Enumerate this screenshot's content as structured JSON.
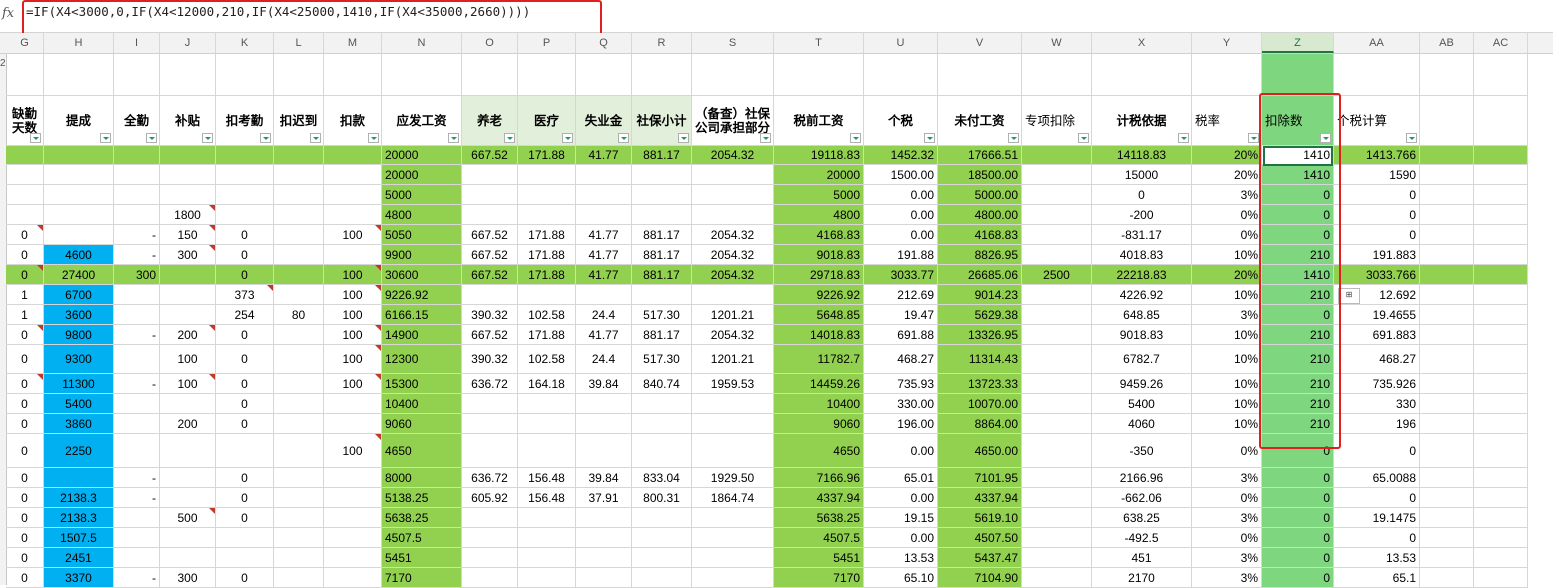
{
  "formula_bar": {
    "fx_label": "fx",
    "formula": "=IF(X4<3000,0,IF(X4<12000,210,IF(X4<25000,1410,IF(X4<35000,2660))))"
  },
  "columns": [
    {
      "key": "G",
      "w": 38
    },
    {
      "key": "H",
      "w": 70
    },
    {
      "key": "I",
      "w": 46
    },
    {
      "key": "J",
      "w": 56
    },
    {
      "key": "K",
      "w": 58
    },
    {
      "key": "L",
      "w": 50
    },
    {
      "key": "M",
      "w": 58
    },
    {
      "key": "N",
      "w": 80
    },
    {
      "key": "O",
      "w": 56
    },
    {
      "key": "P",
      "w": 58
    },
    {
      "key": "Q",
      "w": 56
    },
    {
      "key": "R",
      "w": 60
    },
    {
      "key": "S",
      "w": 82
    },
    {
      "key": "T",
      "w": 90
    },
    {
      "key": "U",
      "w": 74
    },
    {
      "key": "V",
      "w": 84
    },
    {
      "key": "W",
      "w": 70
    },
    {
      "key": "X",
      "w": 100
    },
    {
      "key": "Y",
      "w": 70
    },
    {
      "key": "Z",
      "w": 72
    },
    {
      "key": "AA",
      "w": 86
    },
    {
      "key": "AB",
      "w": 54
    },
    {
      "key": "AC",
      "w": 54
    }
  ],
  "row2_label": "2",
  "headers": [
    "缺勤天数",
    "提成",
    "全勤",
    "补贴",
    "扣考勤",
    "扣迟到",
    "扣款",
    "应发工资",
    "养老",
    "医疗",
    "失业金",
    "社保小计",
    "（备查）社保公司承担部分",
    "税前工资",
    "个税",
    "未付工资",
    "专项扣除",
    "计税依据",
    "税率",
    "扣除数",
    "个税计算",
    "",
    ""
  ],
  "rows": [
    [
      "",
      "",
      "",
      "",
      "",
      "",
      "",
      "20000",
      "667.52",
      "171.88",
      "41.77",
      "881.17",
      "2054.32",
      "19118.83",
      "1452.32",
      "17666.51",
      "",
      "14118.83",
      "20%",
      "1410",
      "1413.766",
      "",
      ""
    ],
    [
      "",
      "",
      "",
      "",
      "",
      "",
      "",
      "20000",
      "",
      "",
      "",
      "",
      "",
      "20000",
      "1500.00",
      "18500.00",
      "",
      "15000",
      "20%",
      "1410",
      "1590",
      "",
      ""
    ],
    [
      "",
      "",
      "",
      "",
      "",
      "",
      "",
      "5000",
      "",
      "",
      "",
      "",
      "",
      "5000",
      "0.00",
      "5000.00",
      "",
      "0",
      "3%",
      "0",
      "0",
      "",
      ""
    ],
    [
      "",
      "",
      "",
      "1800",
      "",
      "",
      "",
      "4800",
      "",
      "",
      "",
      "",
      "",
      "4800",
      "0.00",
      "4800.00",
      "",
      "-200",
      "0%",
      "0",
      "0",
      "",
      ""
    ],
    [
      "0",
      "",
      "-",
      "150",
      "0",
      "",
      "100",
      "5050",
      "667.52",
      "171.88",
      "41.77",
      "881.17",
      "2054.32",
      "4168.83",
      "0.00",
      "4168.83",
      "",
      "-831.17",
      "0%",
      "0",
      "0",
      "",
      ""
    ],
    [
      "0",
      "4600",
      "-",
      "300",
      "0",
      "",
      "",
      "9900",
      "667.52",
      "171.88",
      "41.77",
      "881.17",
      "2054.32",
      "9018.83",
      "191.88",
      "8826.95",
      "",
      "4018.83",
      "10%",
      "210",
      "191.883",
      "",
      ""
    ],
    [
      "0",
      "27400",
      "300",
      "",
      "0",
      "",
      "100",
      "30600",
      "667.52",
      "171.88",
      "41.77",
      "881.17",
      "2054.32",
      "29718.83",
      "3033.77",
      "26685.06",
      "2500",
      "22218.83",
      "20%",
      "1410",
      "3033.766",
      "",
      ""
    ],
    [
      "1",
      "6700",
      "",
      "",
      "373",
      "",
      "100",
      "9226.92",
      "",
      "",
      "",
      "",
      "",
      "9226.92",
      "212.69",
      "9014.23",
      "",
      "4226.92",
      "10%",
      "210",
      "12.692",
      "",
      ""
    ],
    [
      "1",
      "3600",
      "",
      "",
      "254",
      "80",
      "100",
      "6166.15",
      "390.32",
      "102.58",
      "24.4",
      "517.30",
      "1201.21",
      "5648.85",
      "19.47",
      "5629.38",
      "",
      "648.85",
      "3%",
      "0",
      "19.4655",
      "",
      ""
    ],
    [
      "0",
      "9800",
      "-",
      "200",
      "0",
      "",
      "100",
      "14900",
      "667.52",
      "171.88",
      "41.77",
      "881.17",
      "2054.32",
      "14018.83",
      "691.88",
      "13326.95",
      "",
      "9018.83",
      "10%",
      "210",
      "691.883",
      "",
      ""
    ],
    [
      "0",
      "9300",
      "",
      "100",
      "0",
      "",
      "100",
      "12300",
      "390.32",
      "102.58",
      "24.4",
      "517.30",
      "1201.21",
      "11782.7",
      "468.27",
      "11314.43",
      "",
      "6782.7",
      "10%",
      "210",
      "468.27",
      "",
      ""
    ],
    [
      "0",
      "11300",
      "-",
      "100",
      "0",
      "",
      "100",
      "15300",
      "636.72",
      "164.18",
      "39.84",
      "840.74",
      "1959.53",
      "14459.26",
      "735.93",
      "13723.33",
      "",
      "9459.26",
      "10%",
      "210",
      "735.926",
      "",
      ""
    ],
    [
      "0",
      "5400",
      "",
      "",
      "0",
      "",
      "",
      "10400",
      "",
      "",
      "",
      "",
      "",
      "10400",
      "330.00",
      "10070.00",
      "",
      "5400",
      "10%",
      "210",
      "330",
      "",
      ""
    ],
    [
      "0",
      "3860",
      "",
      "200",
      "0",
      "",
      "",
      "9060",
      "",
      "",
      "",
      "",
      "",
      "9060",
      "196.00",
      "8864.00",
      "",
      "4060",
      "10%",
      "210",
      "196",
      "",
      ""
    ],
    [
      "0",
      "2250",
      "",
      "",
      "",
      "",
      "100",
      "4650",
      "",
      "",
      "",
      "",
      "",
      "4650",
      "0.00",
      "4650.00",
      "",
      "-350",
      "0%",
      "0",
      "0",
      "",
      ""
    ],
    [
      "0",
      "",
      "-",
      "",
      "0",
      "",
      "",
      "8000",
      "636.72",
      "156.48",
      "39.84",
      "833.04",
      "1929.50",
      "7166.96",
      "65.01",
      "7101.95",
      "",
      "2166.96",
      "3%",
      "0",
      "65.0088",
      "",
      ""
    ],
    [
      "0",
      "2138.3",
      "-",
      "",
      "0",
      "",
      "",
      "5138.25",
      "605.92",
      "156.48",
      "37.91",
      "800.31",
      "1864.74",
      "4337.94",
      "0.00",
      "4337.94",
      "",
      "-662.06",
      "0%",
      "0",
      "0",
      "",
      ""
    ],
    [
      "0",
      "2138.3",
      "",
      "500",
      "0",
      "",
      "",
      "5638.25",
      "",
      "",
      "",
      "",
      "",
      "5638.25",
      "19.15",
      "5619.10",
      "",
      "638.25",
      "3%",
      "0",
      "19.1475",
      "",
      ""
    ],
    [
      "0",
      "1507.5",
      "",
      "",
      "",
      "",
      "",
      "4507.5",
      "",
      "",
      "",
      "",
      "",
      "4507.5",
      "0.00",
      "4507.50",
      "",
      "-492.5",
      "0%",
      "0",
      "0",
      "",
      ""
    ],
    [
      "0",
      "2451",
      "",
      "",
      "",
      "",
      "",
      "5451",
      "",
      "",
      "",
      "",
      "",
      "5451",
      "13.53",
      "5437.47",
      "",
      "451",
      "3%",
      "0",
      "13.53",
      "",
      ""
    ],
    [
      "0",
      "3370",
      "-",
      "300",
      "0",
      "",
      "",
      "7170",
      "",
      "",
      "",
      "",
      "",
      "7170",
      "65.10",
      "7104.90",
      "",
      "2170",
      "3%",
      "0",
      "65.1",
      "",
      ""
    ]
  ],
  "colors": {
    "green_col": "#92d050",
    "light_green_col": "#7ed67e",
    "header_green": "#e2efda",
    "blue_cell": "#00b0f0",
    "highlight_row": "#92d050",
    "red_box": "#e02020"
  }
}
